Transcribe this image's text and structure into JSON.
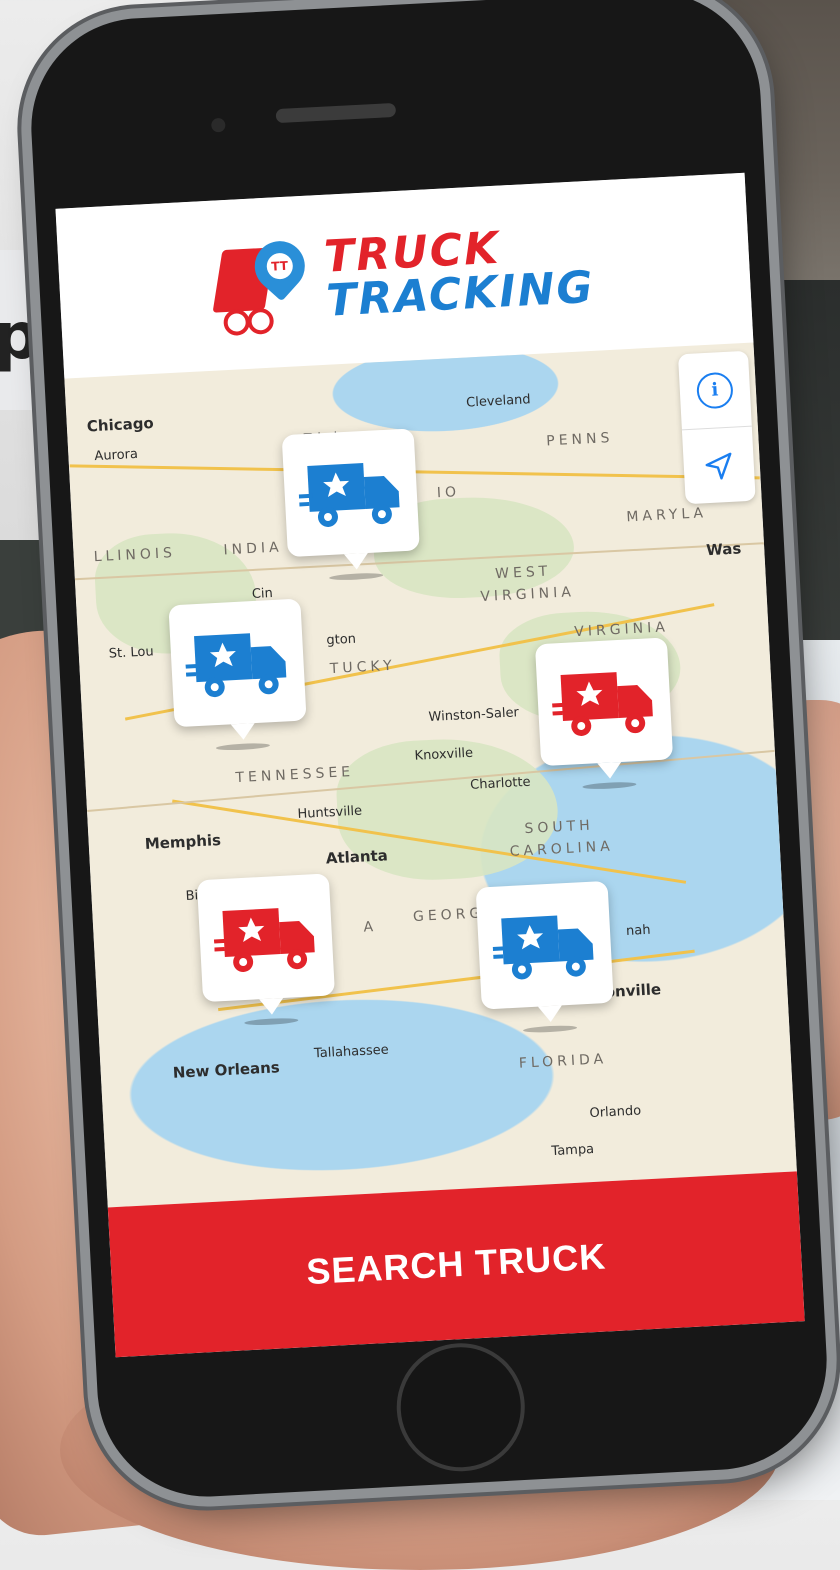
{
  "app": {
    "logo_line1": "TRUCK",
    "logo_line2": "TRACKING",
    "logo_badge": "TT",
    "brand_red": "#e2232a",
    "brand_blue": "#1c7fd1"
  },
  "map": {
    "controls": [
      {
        "name": "info-icon"
      },
      {
        "name": "location-arrow-icon"
      }
    ],
    "cities": [
      "Chicago",
      "Aurora",
      "Toledo",
      "Cleveland",
      "Cin",
      "St. Lou",
      "gton",
      "Winston-Saler",
      "Knoxville",
      "Charlotte",
      "Huntsville",
      "Memphis",
      "Atlanta",
      "Bi",
      "nah",
      "Jacksonville",
      "New Orleans",
      "Tallahassee",
      "Orlando",
      "Tampa",
      "Was"
    ],
    "states": [
      "PENNS",
      "IO",
      "MARYLA",
      "LLINOIS",
      "INDIA",
      "WEST",
      "VIRGINIA",
      "VIRGINIA",
      "TUCKY",
      "TENNESSEE",
      "SOUTH",
      "CAROLINA",
      "A",
      "GEORG",
      "FLORIDA"
    ],
    "markers": [
      {
        "color": "blue"
      },
      {
        "color": "blue"
      },
      {
        "color": "red"
      },
      {
        "color": "red"
      },
      {
        "color": "blue"
      }
    ]
  },
  "search_button": "SEARCH TRUCK",
  "background_sign_text": "pi"
}
